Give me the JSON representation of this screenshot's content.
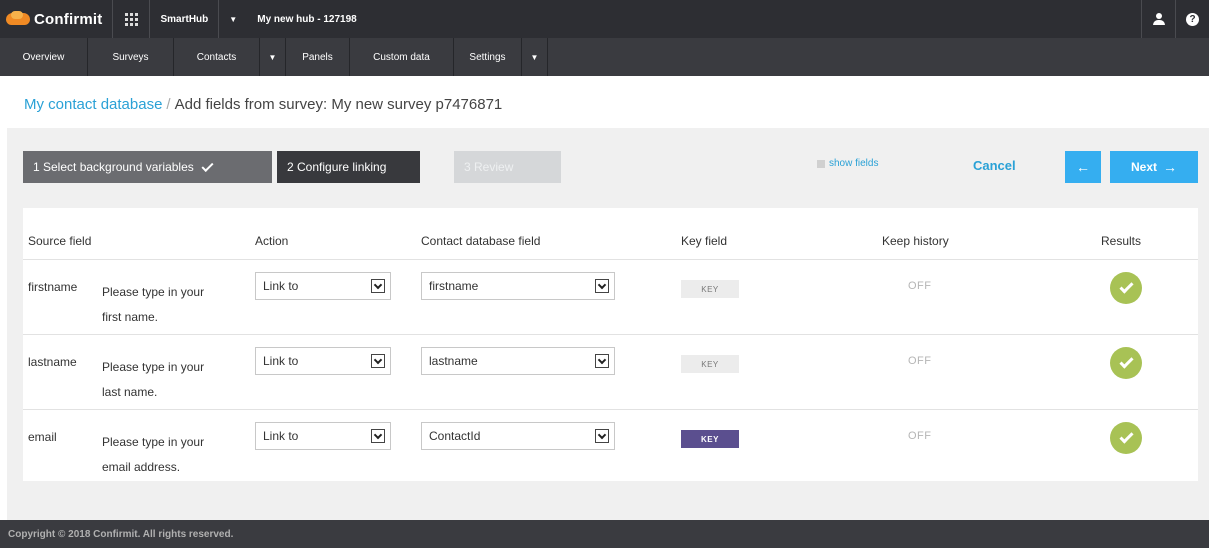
{
  "topbar": {
    "logo": "Confirmit",
    "app_name": "SmartHub",
    "hub_name": "My new hub - 127198"
  },
  "nav": {
    "items": [
      "Overview",
      "Surveys",
      "Contacts",
      "Panels",
      "Custom data",
      "Settings"
    ]
  },
  "breadcrumb": {
    "link": "My contact database",
    "separator": "/",
    "current": "Add fields from survey: My new survey p7476871"
  },
  "steps": {
    "step1": "1 Select background variables",
    "step2": "2 Configure linking",
    "step3": "3 Review"
  },
  "actions": {
    "show_fields": "show fields",
    "cancel": "Cancel",
    "prev": "←",
    "next": "Next",
    "next_arrow": "→"
  },
  "table": {
    "headers": {
      "source": "Source field",
      "action": "Action",
      "contact": "Contact database field",
      "key": "Key field",
      "history": "Keep history",
      "results": "Results"
    },
    "rows": [
      {
        "name": "firstname",
        "desc_line1": "Please type in your",
        "desc_line2": "first name.",
        "action": "Link to",
        "contact_field": "firstname",
        "key": "KEY",
        "key_active": false,
        "history": "OFF",
        "result": "ok"
      },
      {
        "name": "lastname",
        "desc_line1": "Please type in your",
        "desc_line2": "last name.",
        "action": "Link to",
        "contact_field": "lastname",
        "key": "KEY",
        "key_active": false,
        "history": "OFF",
        "result": "ok"
      },
      {
        "name": "email",
        "desc_line1": "Please type in your",
        "desc_line2": "email address.",
        "action": "Link to",
        "contact_field": "ContactId",
        "key": "KEY",
        "key_active": true,
        "history": "OFF",
        "result": "ok"
      }
    ]
  },
  "footer": {
    "copyright": "Copyright © 2018 Confirmit. All rights reserved."
  },
  "colors": {
    "accent": "#35aef0",
    "link": "#2aa1d6",
    "key_active": "#5b4f8f",
    "success": "#a8c255"
  }
}
